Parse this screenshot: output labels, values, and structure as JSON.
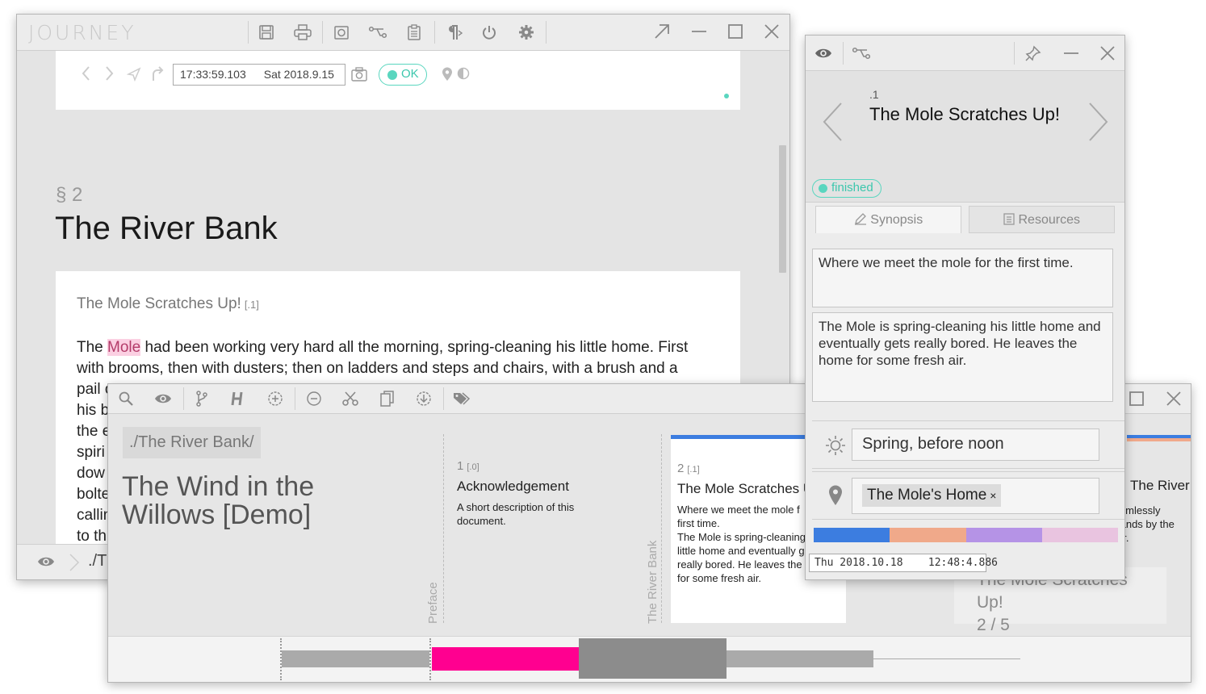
{
  "main": {
    "logo": "JOURNEY",
    "timestamp_time": "17:33:59.103",
    "timestamp_date": "Sat 2018.9.15",
    "status": "OK",
    "section_number": "§ 2",
    "chapter_title": "The River Bank",
    "scene_title": "The Mole Scratches Up!",
    "scene_index": "[.1]",
    "body_before": "The ",
    "body_highlight": "Mole",
    "body_after": " had been working very hard all the morning, spring-cleaning his little home. First with brooms, then with dusters; then on ladders and steps and chairs, with a brush and a",
    "body_visible_line3": "pail o",
    "body_visible_line4": "his b",
    "body_visible_line5": "the e",
    "body_visible_line6": "spiri",
    "body_visible_line7": "dow",
    "body_visible_line8": "bolte",
    "body_visible_line9": "callin",
    "body_visible_line10": "to th",
    "status_path": "./T"
  },
  "bottom": {
    "project_path": "./The River Bank/",
    "project_title": "The Wind in the Willows [Demo]",
    "label_preface": "Preface",
    "label_river_bank": "The River Bank",
    "card1": {
      "num": "1",
      "index": "[.0]",
      "title": "Acknowledgement",
      "text": "A short description of this document."
    },
    "card2": {
      "num": "2",
      "index": "[.1]",
      "title": "The Mole Scratches U",
      "text1": "Where we meet the mole f",
      "text1b": "first time.",
      "text2": "The Mole is spring-cleaning",
      "text3": "little home and eventually g",
      "text4": "really bored. He leaves the",
      "text5": "for some fresh air."
    },
    "card3_title": "The River",
    "card3_text1": "aimlessly",
    "card3_text2": "tands by the",
    "card3_text3": "er.",
    "right_card_title": "The Mole Scratches Up!",
    "right_card_count": "2 / 5"
  },
  "inspector": {
    "scene_num": ".1",
    "scene_title": "The Mole Scratches Up!",
    "status": "finished",
    "tab_synopsis": "Synopsis",
    "tab_resources": "Resources",
    "synopsis_short": "Where we meet the mole for the first time.",
    "synopsis_long": "The Mole is spring-cleaning his little home and eventually gets really bored. He leaves the home for some fresh air.",
    "time_of_day": "Spring, before noon",
    "location_tag": "The Mole's Home",
    "location_remove": "×",
    "footer_date": "Thu 2018.10.18",
    "footer_time": "12:48:4.886"
  },
  "colors": {
    "accent_teal": "#5ad6bf",
    "highlight_pink": "#ff0090",
    "blue": "#3c7de0",
    "salmon": "#f0a98a",
    "lavender": "#b593e6",
    "pale_pink": "#e9c4e0"
  }
}
